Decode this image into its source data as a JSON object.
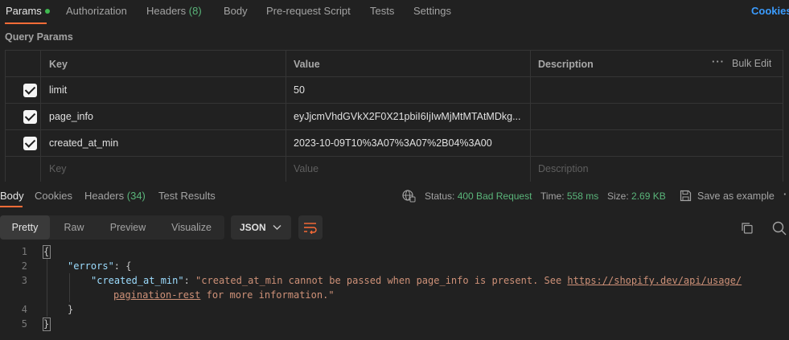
{
  "request_tabs": {
    "params": "Params",
    "authorization": "Authorization",
    "headers": "Headers",
    "headers_count": "(8)",
    "body": "Body",
    "pre_request": "Pre-request Script",
    "tests": "Tests",
    "settings": "Settings",
    "cookies": "Cookies"
  },
  "query_params": {
    "title": "Query Params",
    "columns": {
      "key": "Key",
      "value": "Value",
      "description": "Description"
    },
    "bulk_edit": "Bulk Edit",
    "rows": [
      {
        "key": "limit",
        "value": "50",
        "checked": true
      },
      {
        "key": "page_info",
        "value": "eyJjcmVhdGVkX2F0X21pbiI6IjIwMjMtMTAtMDkg...",
        "checked": true
      },
      {
        "key": "created_at_min",
        "value": "2023-10-09T10%3A07%3A07%2B04%3A00",
        "checked": true
      }
    ],
    "placeholder": {
      "key": "Key",
      "value": "Value",
      "description": "Description"
    }
  },
  "response": {
    "tabs": {
      "body": "Body",
      "cookies": "Cookies",
      "headers": "Headers",
      "headers_count": "(34)",
      "test_results": "Test Results"
    },
    "status_label": "Status:",
    "status_value": "400 Bad Request",
    "time_label": "Time:",
    "time_value": "558 ms",
    "size_label": "Size:",
    "size_value": "2.69 KB",
    "save_example": "Save as example",
    "view_modes": [
      "Pretty",
      "Raw",
      "Preview",
      "Visualize"
    ],
    "format": "JSON"
  },
  "code": {
    "line_numbers": [
      "1",
      "2",
      "3",
      "4",
      "5"
    ],
    "open_brace": "{",
    "errors_key": "\"errors\"",
    "colon_brace": ": {",
    "field_key": "\"created_at_min\"",
    "colon": ": ",
    "message_part1": "\"created_at_min cannot be passed when page_info is present. See ",
    "link_part1": "https://shopify.dev/api/usage/",
    "link_part2": "pagination-rest",
    "message_part2": " for more information.\"",
    "inner_close": "}",
    "close_brace": "}"
  },
  "colors": {
    "accent": "#ff6c37",
    "status_ok_green": "#5ab57a",
    "link_blue": "#3b9cff"
  }
}
